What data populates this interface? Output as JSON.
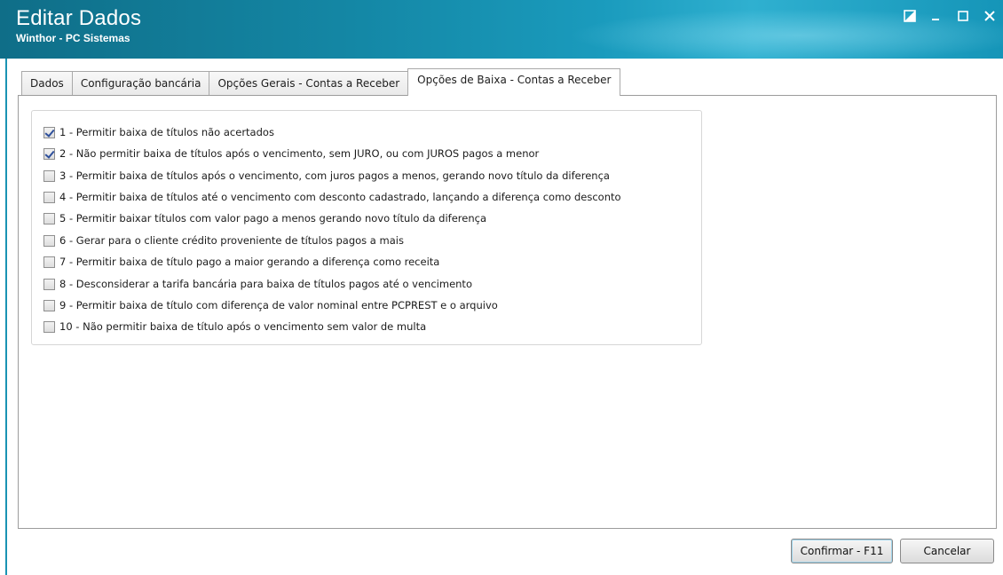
{
  "window": {
    "title": "Editar Dados",
    "subtitle": "Winthor - PC Sistemas"
  },
  "tabs": [
    {
      "label": "Dados",
      "active": false
    },
    {
      "label": "Configuração bancária",
      "active": false
    },
    {
      "label": "Opções Gerais - Contas a Receber",
      "active": false
    },
    {
      "label": "Opções de Baixa - Contas a Receber",
      "active": true
    }
  ],
  "options": [
    {
      "label": "1 - Permitir baixa de títulos não acertados",
      "checked": true
    },
    {
      "label": "2 - Não permitir baixa de títulos após o vencimento, sem JURO, ou com JUROS pagos a menor",
      "checked": true
    },
    {
      "label": "3 - Permitir baixa de títulos após o vencimento, com juros pagos a menos, gerando novo título da diferença",
      "checked": false
    },
    {
      "label": "4 - Permitir baixa de títulos até o vencimento com desconto cadastrado, lançando a diferença como desconto",
      "checked": false
    },
    {
      "label": "5 - Permitir baixar títulos com valor pago a menos gerando novo título da diferença",
      "checked": false
    },
    {
      "label": "6 - Gerar para o cliente crédito proveniente de títulos pagos a mais",
      "checked": false
    },
    {
      "label": "7 - Permitir baixa de título pago a maior gerando a diferença como receita",
      "checked": false
    },
    {
      "label": "8 - Desconsiderar a tarifa bancária para baixa de títulos pagos até o vencimento",
      "checked": false
    },
    {
      "label": "9 - Permitir baixa de título com diferença de valor nominal entre PCPREST e o arquivo",
      "checked": false
    },
    {
      "label": "10 - Não permitir baixa de título após o vencimento sem valor de multa",
      "checked": false
    }
  ],
  "buttons": {
    "confirm": "Confirmar - F11",
    "cancel": "Cancelar"
  },
  "colors": {
    "titlebar": "#1487a5",
    "accent": "#1a93b3"
  }
}
